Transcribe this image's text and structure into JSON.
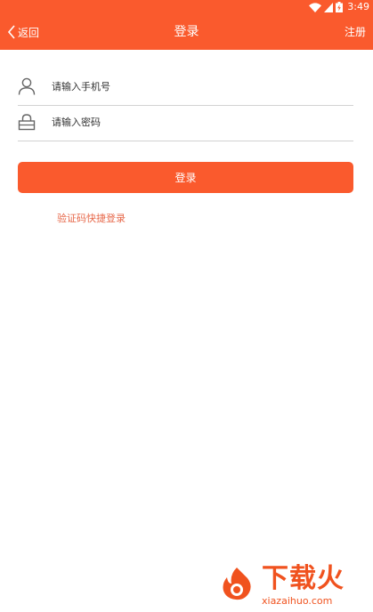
{
  "status_bar": {
    "time": "3:49",
    "icons": [
      "wifi-icon",
      "signal-icon",
      "battery-charging-icon"
    ]
  },
  "header": {
    "back_label": "返回",
    "title": "登录",
    "register_label": "注册"
  },
  "form": {
    "phone_placeholder": "请输入手机号",
    "password_placeholder": "请输入密码",
    "phone_icon": "user-icon",
    "password_icon": "lock-icon",
    "login_label": "登录",
    "sms_login_label": "验证码快捷登录"
  },
  "watermark": {
    "brand": "下载火",
    "url": "xiazaihuo.com"
  },
  "colors": {
    "accent": "#fa5a2d",
    "link": "#e7684a",
    "divider": "#d2d2d2"
  }
}
